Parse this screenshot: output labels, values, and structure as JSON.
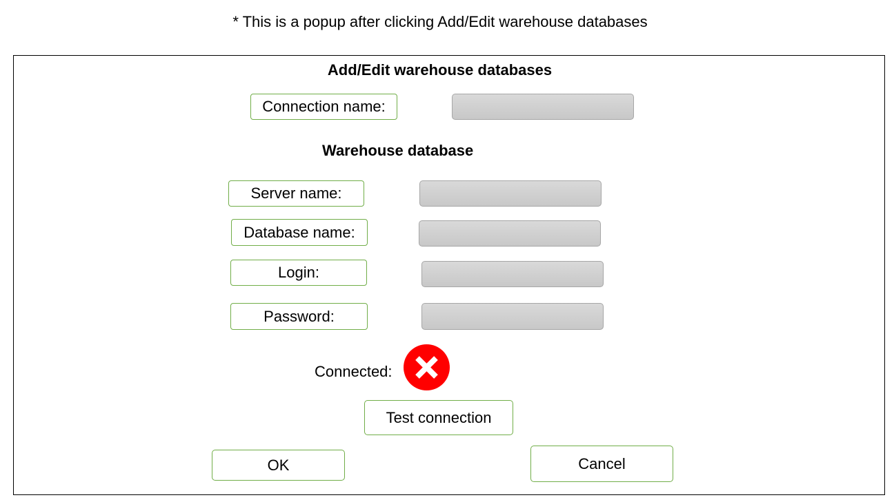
{
  "note": "* This is a popup after clicking Add/Edit warehouse databases",
  "dialog": {
    "title": "Add/Edit warehouse databases",
    "connection_name": {
      "label": "Connection name:",
      "value": ""
    },
    "warehouse_section": {
      "title": "Warehouse database",
      "server_name": {
        "label": "Server name:",
        "value": ""
      },
      "database_name": {
        "label": "Database name:",
        "value": ""
      },
      "login": {
        "label": "Login:",
        "value": ""
      },
      "password": {
        "label": "Password:",
        "value": ""
      }
    },
    "status": {
      "label": "Connected:",
      "icon": "error-x-icon",
      "icon_color": "#ff0000"
    },
    "test_connection_label": "Test connection",
    "ok_label": "OK",
    "cancel_label": "Cancel"
  },
  "colors": {
    "label_border": "#70ad47",
    "field_fill": "#d0d0d0",
    "dialog_border": "#000000"
  }
}
